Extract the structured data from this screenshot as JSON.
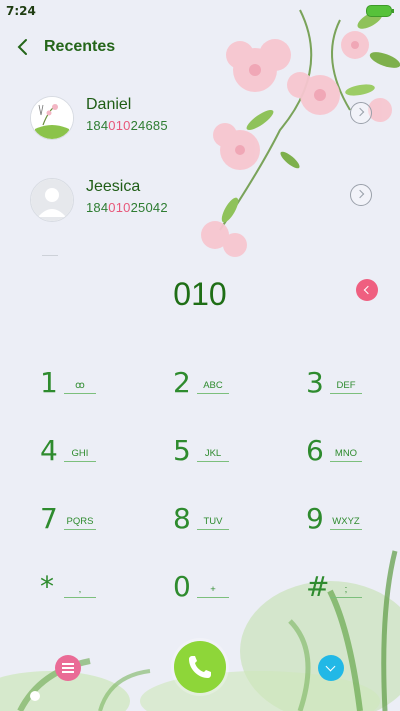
{
  "status_bar": {
    "time": "7:24"
  },
  "header": {
    "title": "Recentes"
  },
  "contacts": [
    {
      "name": "Daniel",
      "number_prefix": "184",
      "number_match": "010",
      "number_suffix": "24685"
    },
    {
      "name": "Jeesica",
      "number_prefix": "184",
      "number_match": "010",
      "number_suffix": "25042"
    }
  ],
  "dialed_number": "010",
  "keypad": [
    {
      "digit": "1",
      "letters": "ꝏ"
    },
    {
      "digit": "2",
      "letters": "ABC"
    },
    {
      "digit": "3",
      "letters": "DEF"
    },
    {
      "digit": "4",
      "letters": "GHI"
    },
    {
      "digit": "5",
      "letters": "JKL"
    },
    {
      "digit": "6",
      "letters": "MNO"
    },
    {
      "digit": "7",
      "letters": "PQRS"
    },
    {
      "digit": "8",
      "letters": "TUV"
    },
    {
      "digit": "9",
      "letters": "WXYZ"
    },
    {
      "digit": "*",
      "letters": ","
    },
    {
      "digit": "0",
      "letters": "+"
    },
    {
      "digit": "#",
      "letters": ";"
    }
  ],
  "colors": {
    "accent_green": "#2e8b2e",
    "highlight_pink": "#e8577a",
    "call_button": "#8ed639",
    "menu_button": "#ea6b96",
    "collapse_button": "#22b8e6"
  }
}
